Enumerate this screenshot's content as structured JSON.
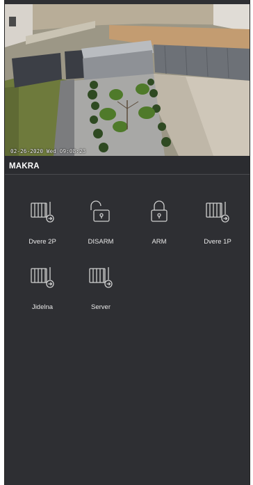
{
  "camera": {
    "timestamp": "02-26-2020 Wed 09:08:23"
  },
  "section": {
    "title": "MAKRA"
  },
  "macros": [
    {
      "label": "Dvere 2P",
      "icon": "gate-key-icon"
    },
    {
      "label": "DISARM",
      "icon": "unlock-icon"
    },
    {
      "label": "ARM",
      "icon": "lock-icon"
    },
    {
      "label": "Dvere 1P",
      "icon": "gate-key-icon"
    },
    {
      "label": "Jidelna",
      "icon": "gate-key-icon"
    },
    {
      "label": "Server",
      "icon": "gate-key-icon"
    }
  ],
  "colors": {
    "background": "#2e2f33",
    "icon": "#d0d0d0",
    "text": "#e8e8e8"
  }
}
